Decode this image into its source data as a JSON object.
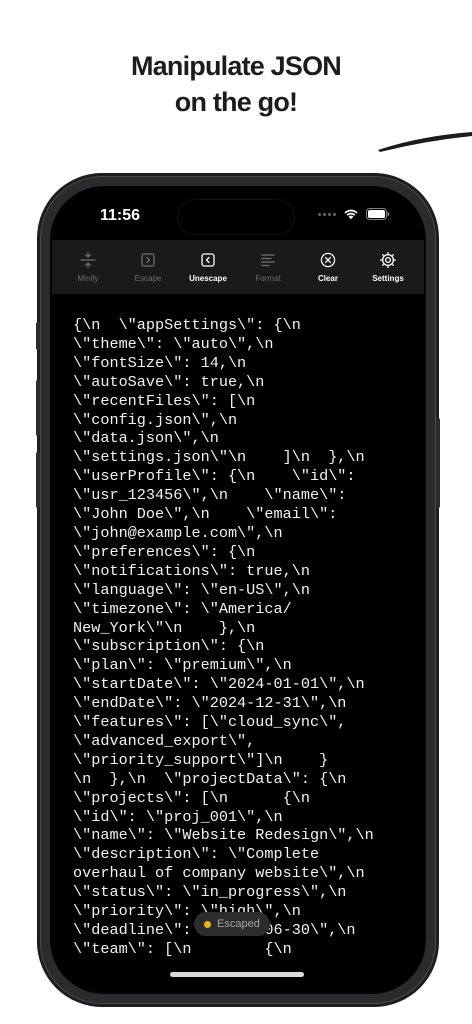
{
  "headline": {
    "line1": "Manipulate JSON",
    "line2": "on the go!"
  },
  "status_bar": {
    "time": "11:56"
  },
  "toolbar": {
    "items": [
      {
        "label": "Minify",
        "icon": "minify-icon",
        "active": false
      },
      {
        "label": "Escape",
        "icon": "escape-icon",
        "active": false
      },
      {
        "label": "Unescape",
        "icon": "unescape-icon",
        "active": true
      },
      {
        "label": "Format",
        "icon": "format-icon",
        "active": false
      },
      {
        "label": "Clear",
        "icon": "clear-icon",
        "active": true
      },
      {
        "label": "Settings",
        "icon": "gear-icon",
        "active": true
      }
    ]
  },
  "editor": {
    "lines": [
      "{\\n  \\\"appSettings\\\": {\\n",
      "\\\"theme\\\": \\\"auto\\\",\\n",
      "\\\"fontSize\\\": 14,\\n",
      "\\\"autoSave\\\": true,\\n",
      "\\\"recentFiles\\\": [\\n",
      "\\\"config.json\\\",\\n",
      "\\\"data.json\\\",\\n",
      "\\\"settings.json\\\"\\n    ]\\n  },\\n",
      "\\\"userProfile\\\": {\\n    \\\"id\\\":",
      "\\\"usr_123456\\\",\\n    \\\"name\\\":",
      "\\\"John Doe\\\",\\n    \\\"email\\\":",
      "\\\"john@example.com\\\",\\n",
      "\\\"preferences\\\": {\\n",
      "\\\"notifications\\\": true,\\n",
      "\\\"language\\\": \\\"en-US\\\",\\n",
      "\\\"timezone\\\": \\\"America/",
      "New_York\\\"\\n    },\\n",
      "\\\"subscription\\\": {\\n",
      "\\\"plan\\\": \\\"premium\\\",\\n",
      "\\\"startDate\\\": \\\"2024-01-01\\\",\\n",
      "\\\"endDate\\\": \\\"2024-12-31\\\",\\n",
      "\\\"features\\\": [\\\"cloud_sync\\\",",
      "\\\"advanced_export\\\",",
      "\\\"priority_support\\\"]\\n    }",
      "\\n  },\\n  \\\"projectData\\\": {\\n",
      "\\\"projects\\\": [\\n      {\\n",
      "\\\"id\\\": \\\"proj_001\\\",\\n",
      "\\\"name\\\": \\\"Website Redesign\\\",\\n",
      "\\\"description\\\": \\\"Complete",
      "overhaul of company website\\\",\\n",
      "\\\"status\\\": \\\"in_progress\\\",\\n",
      "\\\"priority\\\": \\\"high\\\",\\n",
      "\\\"deadline\\\": \\\"2024-06-30\\\",\\n",
      "\\\"team\\\": [\\n        {\\n"
    ]
  },
  "toast": {
    "label": "Escaped",
    "dot_color": "#e9b417"
  }
}
